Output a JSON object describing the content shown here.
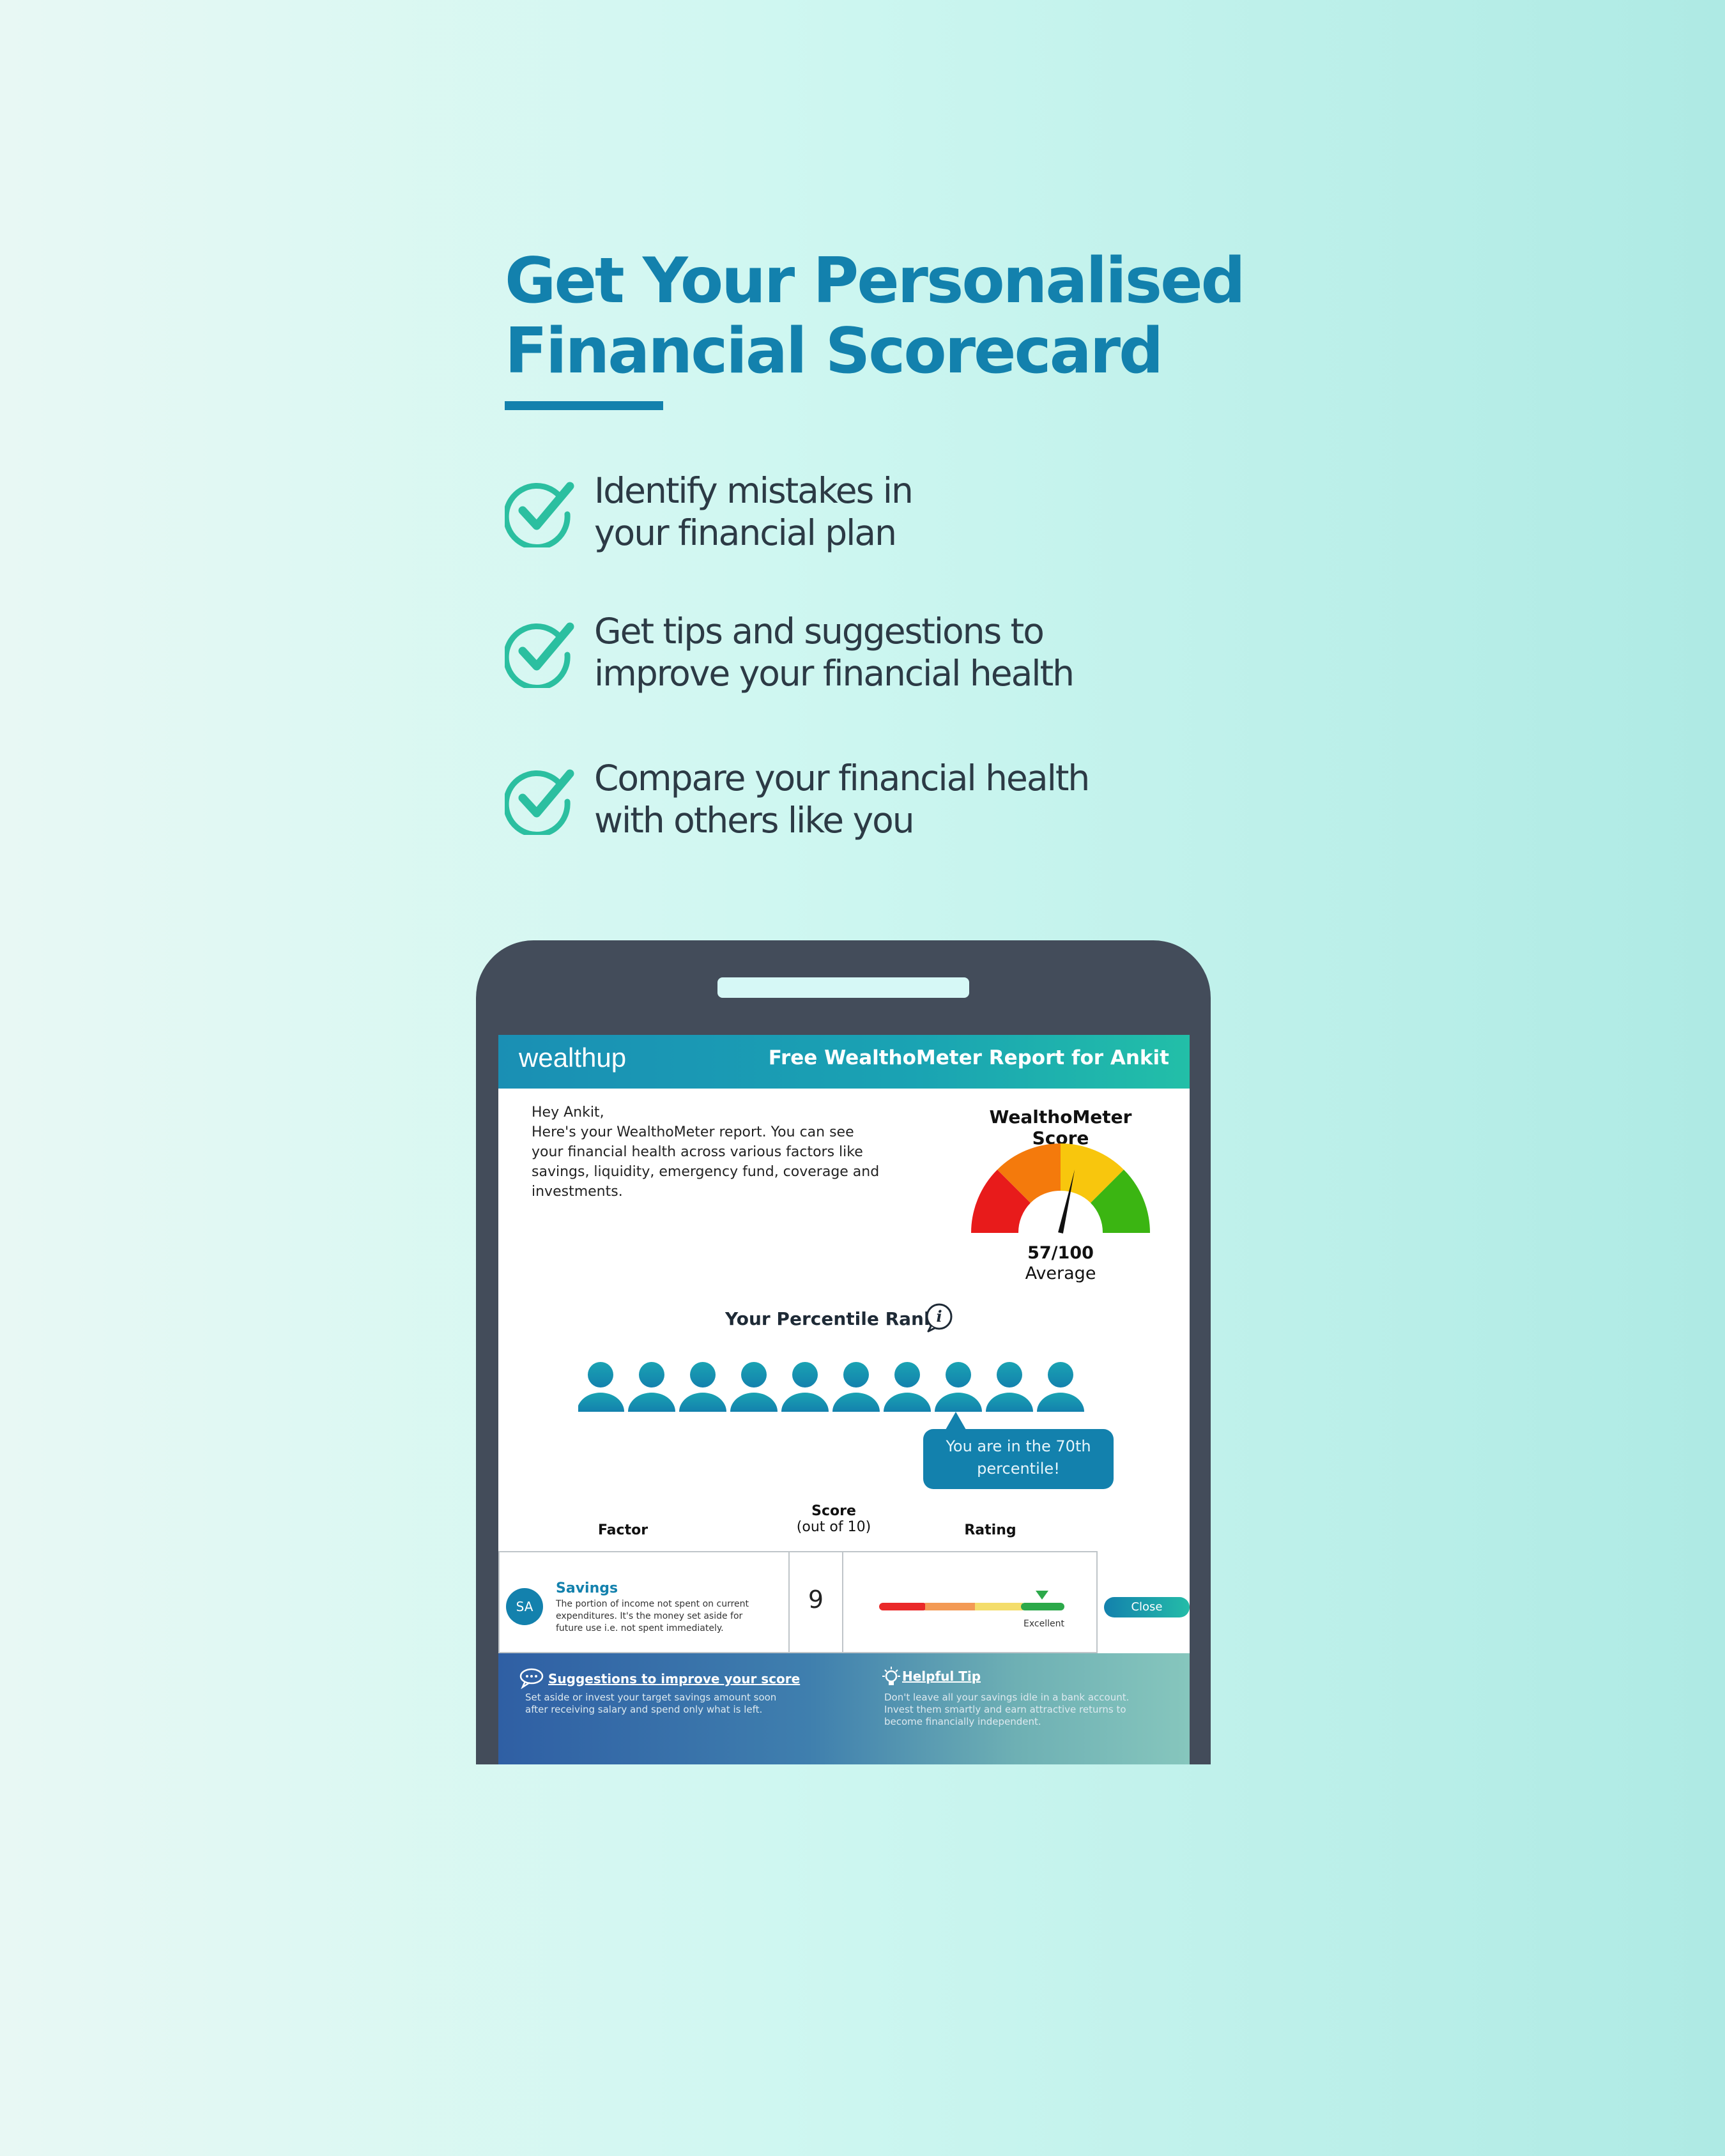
{
  "header": {
    "title_line1": "Get Your Personalised",
    "title_line2": "Financial Scorecard"
  },
  "features": [
    {
      "line1": "Identify mistakes in",
      "line2": "your financial plan",
      "icon": "check-circle-icon"
    },
    {
      "line1": "Get tips and suggestions to",
      "line2": "improve your financial health",
      "icon": "check-circle-icon"
    },
    {
      "line1": "Compare your financial health",
      "line2": "with others like you",
      "icon": "check-circle-icon"
    }
  ],
  "report": {
    "logo": "wealthup",
    "banner_title": "Free WealthoMeter Report for Ankit",
    "greeting_line1": "Hey Ankit,",
    "greeting_body": "Here's your WealthoMeter report. You can see your financial health across various factors like savings, liquidity, emergency fund, coverage and investments.",
    "score_title": "WealthoMeter Score",
    "score_value": "57/100",
    "score_category": "Average",
    "score_numeric": 57,
    "percentile_title": "Your Percentile Rank",
    "percentile_message": "You are in the 70th percentile!",
    "percentile_position": 8,
    "people_count": 10,
    "table": {
      "col_factor": "Factor",
      "col_score": "Score",
      "col_score_sub": "(out of 10)",
      "col_rating": "Rating",
      "row": {
        "badge": "SA",
        "factor": "Savings",
        "description": "The portion of income not spent on current expenditures. It's the money set aside for future use i.e. not spent immediately.",
        "score": "9",
        "rating_label": "Excellent",
        "action": "Close"
      }
    },
    "suggestions_title": "Suggestions to improve your score",
    "suggestions_text": "Set aside or invest your target savings amount soon after receiving salary and spend only what is left.",
    "tip_title": "Helpful Tip",
    "tip_text": "Don't leave all your savings idle in a bank account. Invest them smartly and earn attractive returns to become financially independent."
  },
  "colors": {
    "brand_blue": "#1381ad",
    "check_green": "#2bbfa0",
    "phone_frame": "#434c5a"
  }
}
